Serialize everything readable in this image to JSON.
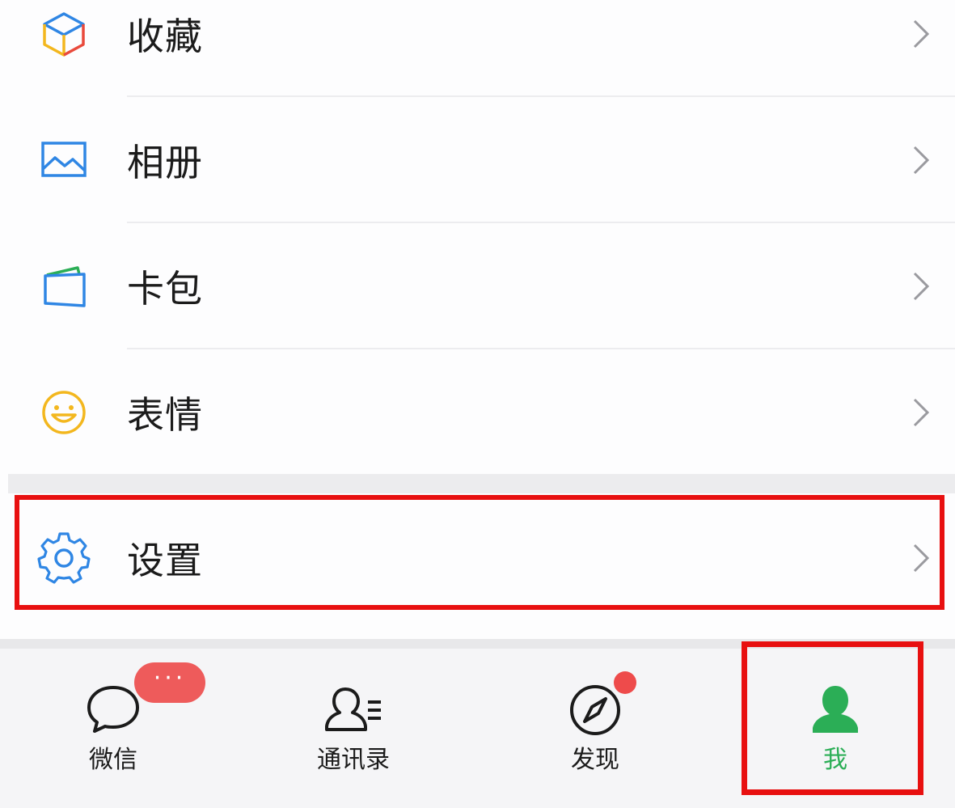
{
  "menu": {
    "items": [
      {
        "label": "收藏",
        "icon": "favorites-cube-icon"
      },
      {
        "label": "相册",
        "icon": "album-picture-icon"
      },
      {
        "label": "卡包",
        "icon": "card-wallet-icon"
      },
      {
        "label": "表情",
        "icon": "sticker-smiley-icon"
      },
      {
        "label": "设置",
        "icon": "settings-gear-icon"
      }
    ]
  },
  "tabbar": {
    "tabs": [
      {
        "label": "微信",
        "icon": "chat-bubble-icon",
        "badge": "···"
      },
      {
        "label": "通讯录",
        "icon": "contacts-icon"
      },
      {
        "label": "发现",
        "icon": "compass-icon"
      },
      {
        "label": "我",
        "icon": "me-person-icon",
        "active": true
      }
    ]
  },
  "colors": {
    "accent_green": "#2bae56",
    "highlight_red": "#e81010",
    "badge_red": "#ee5b5b",
    "icon_blue": "#2f86e4"
  }
}
